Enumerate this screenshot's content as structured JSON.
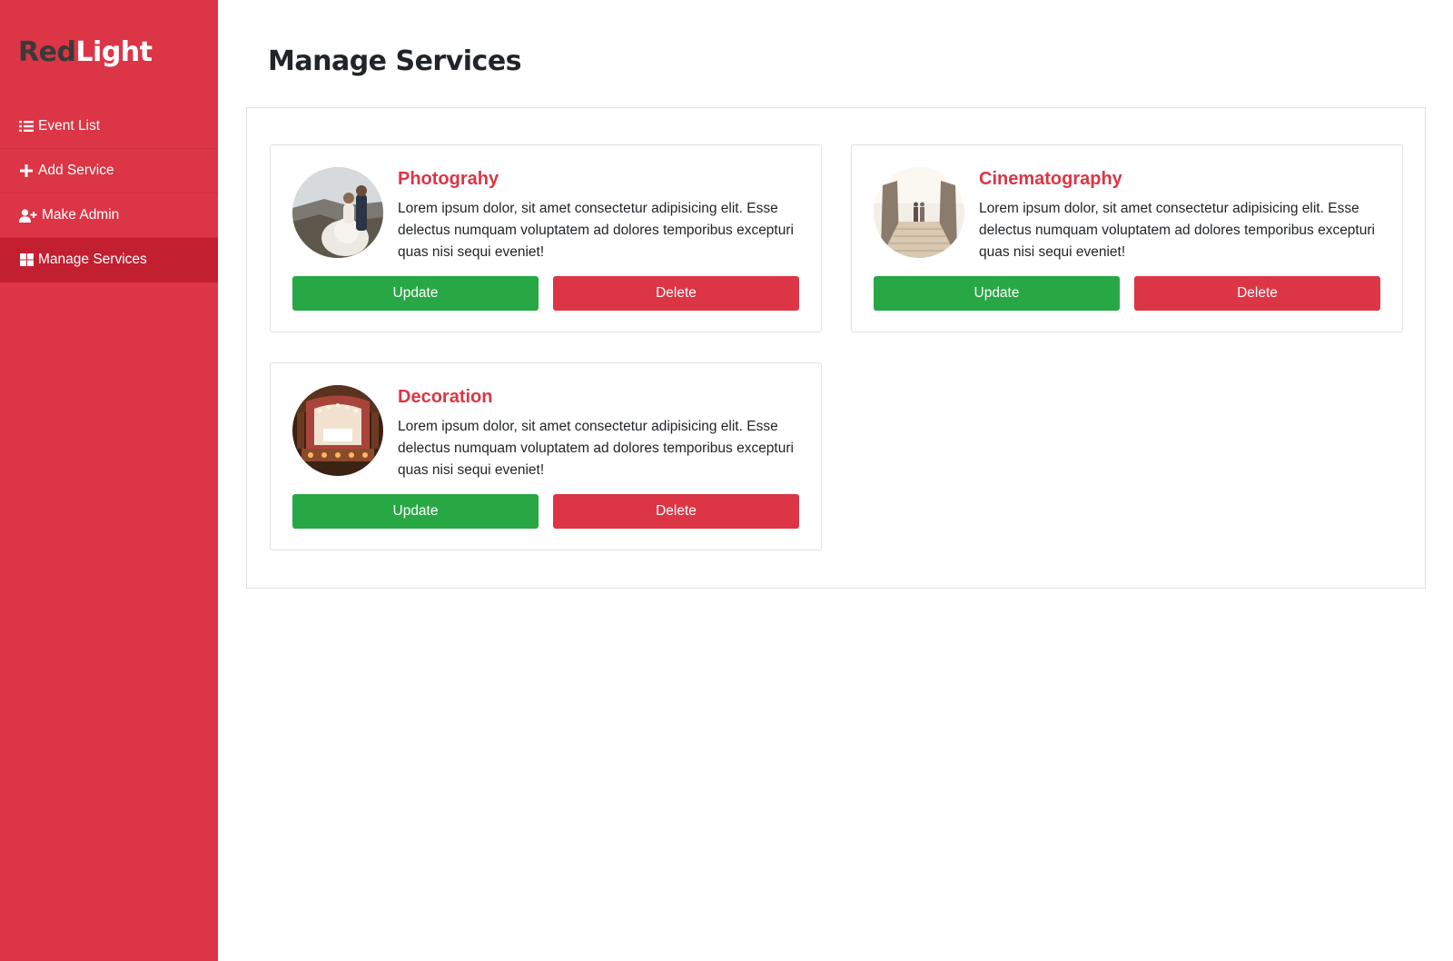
{
  "brand": {
    "part1": "Red",
    "part2": "Light"
  },
  "sidebar": {
    "items": [
      {
        "label": "Event List",
        "icon": "list-icon",
        "active": false
      },
      {
        "label": "Add Service",
        "icon": "plus-icon",
        "active": false
      },
      {
        "label": "Make Admin",
        "icon": "user-plus-icon",
        "active": false
      },
      {
        "label": "Manage Services",
        "icon": "grid-icon",
        "active": true
      }
    ]
  },
  "page": {
    "title": "Manage Services"
  },
  "services": [
    {
      "title": "Photograhy",
      "description": "Lorem ipsum dolor, sit amet consectetur adipisicing elit. Esse delectus numquam voluptatem ad dolores temporibus excepturi quas nisi sequi eveniet!",
      "update_label": "Update",
      "delete_label": "Delete",
      "image": "wedding-couple-photo"
    },
    {
      "title": "Cinematography",
      "description": "Lorem ipsum dolor, sit amet consectetur adipisicing elit. Esse delectus numquam voluptatem ad dolores temporibus excepturi quas nisi sequi eveniet!",
      "update_label": "Update",
      "delete_label": "Delete",
      "image": "couple-on-stairs-photo"
    },
    {
      "title": "Decoration",
      "description": "Lorem ipsum dolor, sit amet consectetur adipisicing elit. Esse delectus numquam voluptatem ad dolores temporibus excepturi quas nisi sequi eveniet!",
      "update_label": "Update",
      "delete_label": "Delete",
      "image": "wedding-stage-decoration-photo"
    }
  ],
  "colors": {
    "primary": "#dc3545",
    "active_nav": "#c21f31",
    "update": "#28a745",
    "delete": "#dc3545"
  }
}
